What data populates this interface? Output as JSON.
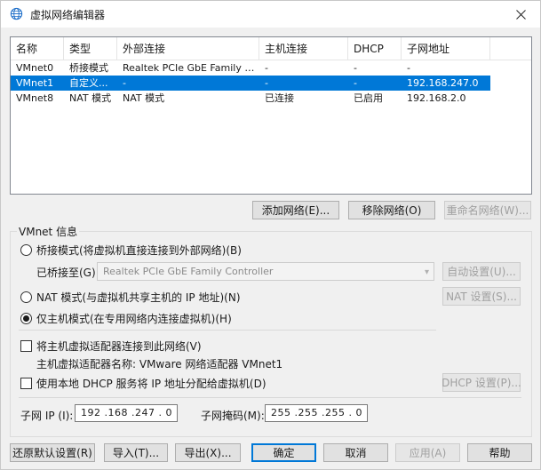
{
  "window": {
    "title": "虚拟网络编辑器"
  },
  "table": {
    "columns": [
      "名称",
      "类型",
      "外部连接",
      "主机连接",
      "DHCP",
      "子网地址"
    ],
    "rows": [
      {
        "name": "VMnet0",
        "type": "桥接模式",
        "external": "Realtek PCIe GbE Family Co...",
        "host": "-",
        "dhcp": "-",
        "subnet": "-"
      },
      {
        "name": "VMnet1",
        "type": "自定义...",
        "external": "-",
        "host": "-",
        "dhcp": "-",
        "subnet": "192.168.247.0",
        "selected": true
      },
      {
        "name": "VMnet8",
        "type": "NAT 模式",
        "external": "NAT 模式",
        "host": "已连接",
        "dhcp": "已启用",
        "subnet": "192.168.2.0"
      }
    ]
  },
  "net_buttons": {
    "add": "添加网络(E)...",
    "remove": "移除网络(O)",
    "rename": "重命名网络(W)..."
  },
  "vmnet_info": {
    "title": "VMnet 信息",
    "bridged_radio": "桥接模式(将虚拟机直接连接到外部网络)(B)",
    "bridged_to_label": "已桥接至(G):",
    "bridged_to_value": "Realtek PCIe GbE Family Controller",
    "auto_settings": "自动设置(U)...",
    "nat_radio": "NAT 模式(与虚拟机共享主机的 IP 地址)(N)",
    "nat_settings": "NAT 设置(S)...",
    "hostonly_radio": "仅主机模式(在专用网络内连接虚拟机)(H)",
    "selected_mode": "hostonly",
    "connect_adapter": "将主机虚拟适配器连接到此网络(V)",
    "adapter_name": "主机虚拟适配器名称: VMware 网络适配器 VMnet1",
    "use_dhcp": "使用本地 DHCP 服务将 IP 地址分配给虚拟机(D)",
    "dhcp_settings": "DHCP 设置(P)...",
    "subnet_ip_label": "子网 IP (I):",
    "subnet_ip": "192 .168 .247 . 0",
    "mask_label": "子网掩码(M):",
    "mask": "255 .255 .255 . 0"
  },
  "footer": {
    "restore": "还原默认设置(R)",
    "import": "导入(T)...",
    "export": "导出(X)...",
    "ok": "确定",
    "cancel": "取消",
    "apply": "应用(A)",
    "help": "帮助"
  },
  "colors": {
    "selection": "#0078d7",
    "accent": "#0078d7"
  },
  "icons": {
    "app": "globe-network-icon",
    "close": "close-icon",
    "dropdown": "chevron-down-icon"
  }
}
